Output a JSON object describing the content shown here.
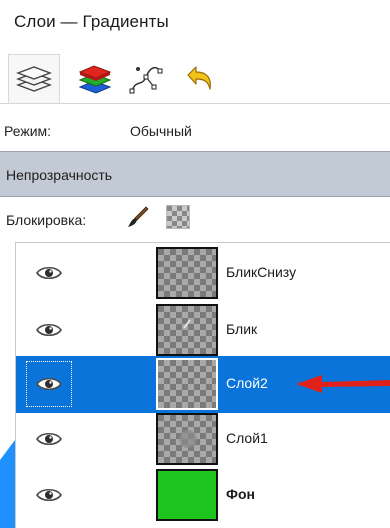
{
  "window": {
    "title": "Слои — Градиенты"
  },
  "toolbar": {
    "tabs": [
      {
        "name": "layers-tab",
        "icon": "layers-icon",
        "active": true
      },
      {
        "name": "channels-tab",
        "icon": "channels-icon",
        "active": false
      },
      {
        "name": "paths-tab",
        "icon": "paths-icon",
        "active": false
      },
      {
        "name": "undo-history-tab",
        "icon": "undo-icon",
        "active": false
      }
    ]
  },
  "mode": {
    "label": "Режим:",
    "value": "Обычный"
  },
  "opacity": {
    "label": "Непрозрачность"
  },
  "lock": {
    "label": "Блокировка:",
    "icons": [
      "brush-icon",
      "alpha-lock-icon"
    ]
  },
  "layers": [
    {
      "name": "БликСнизу",
      "visible": true,
      "selected": false,
      "bold": false
    },
    {
      "name": "Блик",
      "visible": true,
      "selected": false,
      "bold": false
    },
    {
      "name": "Слой2",
      "visible": true,
      "selected": true,
      "bold": false
    },
    {
      "name": "Слой1",
      "visible": true,
      "selected": false,
      "bold": false
    },
    {
      "name": "Фон",
      "visible": true,
      "selected": false,
      "bold": true
    }
  ],
  "colors": {
    "selection": "#0a74da",
    "opacity_bar": "#c2cad5",
    "background_layer_fill": "#1ec51e",
    "annotation_arrow": "#e0201b"
  }
}
